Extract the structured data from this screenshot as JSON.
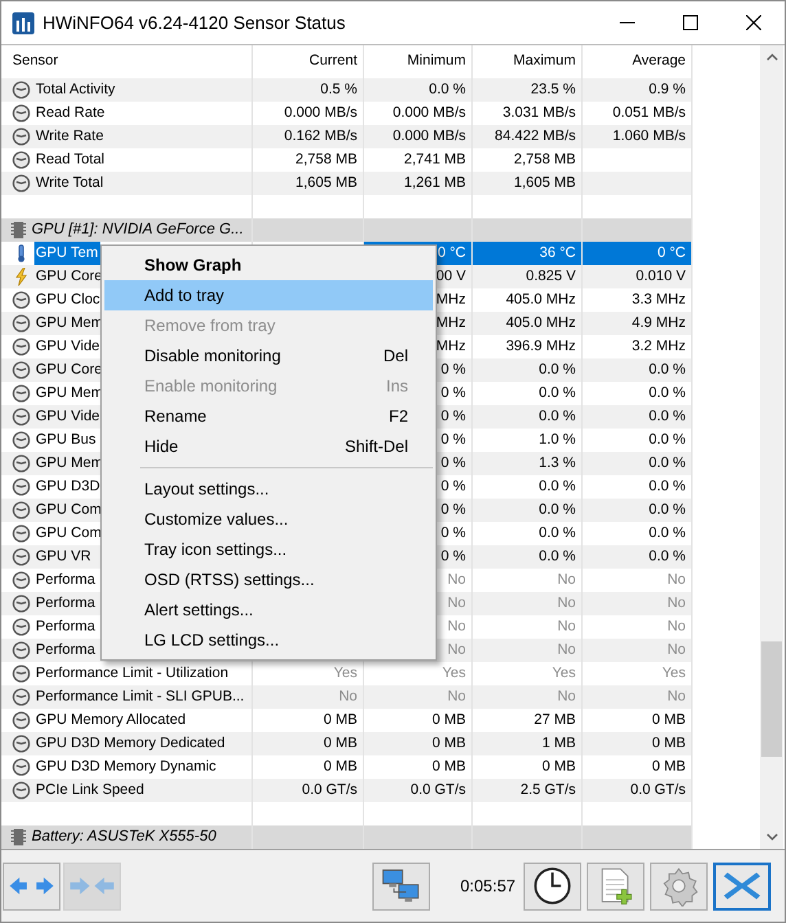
{
  "window": {
    "title": "HWiNFO64 v6.24-4120 Sensor Status"
  },
  "columns": [
    "Sensor",
    "Current",
    "Minimum",
    "Maximum",
    "Average"
  ],
  "rows": [
    {
      "kind": "gauge",
      "sensor": "Total Activity",
      "current": "0.5 %",
      "minimum": "0.0 %",
      "maximum": "23.5 %",
      "average": "0.9 %",
      "dimmed": false,
      "selected": false
    },
    {
      "kind": "gauge",
      "sensor": "Read Rate",
      "current": "0.000 MB/s",
      "minimum": "0.000 MB/s",
      "maximum": "3.031 MB/s",
      "average": "0.051 MB/s",
      "dimmed": false,
      "selected": false
    },
    {
      "kind": "gauge",
      "sensor": "Write Rate",
      "current": "0.162 MB/s",
      "minimum": "0.000 MB/s",
      "maximum": "84.422 MB/s",
      "average": "1.060 MB/s",
      "dimmed": false,
      "selected": false
    },
    {
      "kind": "gauge",
      "sensor": "Read Total",
      "current": "2,758 MB",
      "minimum": "2,741 MB",
      "maximum": "2,758 MB",
      "dimmed": false,
      "selected": false
    },
    {
      "kind": "gauge",
      "sensor": "Write Total",
      "current": "1,605 MB",
      "minimum": "1,261 MB",
      "maximum": "1,605 MB",
      "dimmed": false,
      "selected": false
    },
    {
      "kind": "blank"
    },
    {
      "kind": "header",
      "label": "GPU [#1]: NVIDIA GeForce G..."
    },
    {
      "kind": "temperature",
      "sensor": "GPU Tem",
      "minimum": "0 °C",
      "maximum": "36 °C",
      "average": "0 °C",
      "dimmed": false,
      "selected": true
    },
    {
      "kind": "voltage",
      "sensor": "GPU Core",
      "minimum": "00 V",
      "maximum": "0.825 V",
      "average": "0.010 V",
      "dimmed": false,
      "selected": false
    },
    {
      "kind": "gauge",
      "sensor": "GPU Cloc",
      "minimum": "MHz",
      "maximum": "405.0 MHz",
      "average": "3.3 MHz",
      "dimmed": false,
      "selected": false
    },
    {
      "kind": "gauge",
      "sensor": "GPU Mem",
      "minimum": "MHz",
      "maximum": "405.0 MHz",
      "average": "4.9 MHz",
      "dimmed": false,
      "selected": false
    },
    {
      "kind": "gauge",
      "sensor": "GPU Vide",
      "minimum": "MHz",
      "maximum": "396.9 MHz",
      "average": "3.2 MHz",
      "dimmed": false,
      "selected": false
    },
    {
      "kind": "gauge",
      "sensor": "GPU Core",
      "minimum": "0 %",
      "maximum": "0.0 %",
      "average": "0.0 %",
      "dimmed": false,
      "selected": false
    },
    {
      "kind": "gauge",
      "sensor": "GPU Mem",
      "minimum": "0 %",
      "maximum": "0.0 %",
      "average": "0.0 %",
      "dimmed": false,
      "selected": false
    },
    {
      "kind": "gauge",
      "sensor": "GPU Vide",
      "minimum": "0 %",
      "maximum": "0.0 %",
      "average": "0.0 %",
      "dimmed": false,
      "selected": false
    },
    {
      "kind": "gauge",
      "sensor": "GPU Bus",
      "minimum": "0 %",
      "maximum": "1.0 %",
      "average": "0.0 %",
      "dimmed": false,
      "selected": false
    },
    {
      "kind": "gauge",
      "sensor": "GPU Mem",
      "minimum": "0 %",
      "maximum": "1.3 %",
      "average": "0.0 %",
      "dimmed": false,
      "selected": false
    },
    {
      "kind": "gauge",
      "sensor": "GPU D3D",
      "minimum": "0 %",
      "maximum": "0.0 %",
      "average": "0.0 %",
      "dimmed": false,
      "selected": false
    },
    {
      "kind": "gauge",
      "sensor": "GPU Com",
      "minimum": "0 %",
      "maximum": "0.0 %",
      "average": "0.0 %",
      "dimmed": false,
      "selected": false
    },
    {
      "kind": "gauge",
      "sensor": "GPU Com",
      "minimum": "0 %",
      "maximum": "0.0 %",
      "average": "0.0 %",
      "dimmed": false,
      "selected": false
    },
    {
      "kind": "gauge",
      "sensor": "GPU VR",
      "minimum": "0 %",
      "maximum": "0.0 %",
      "average": "0.0 %",
      "dimmed": false,
      "selected": false
    },
    {
      "kind": "gauge",
      "sensor": "Performa",
      "minimum": "No",
      "maximum": "No",
      "average": "No",
      "dimmed": true,
      "selected": false
    },
    {
      "kind": "gauge",
      "sensor": "Performa",
      "minimum": "No",
      "maximum": "No",
      "average": "No",
      "dimmed": true,
      "selected": false
    },
    {
      "kind": "gauge",
      "sensor": "Performa",
      "minimum": "No",
      "maximum": "No",
      "average": "No",
      "dimmed": true,
      "selected": false
    },
    {
      "kind": "gauge",
      "sensor": "Performa",
      "minimum": "No",
      "maximum": "No",
      "average": "No",
      "dimmed": true,
      "selected": false
    },
    {
      "kind": "gauge",
      "sensor": "Performance Limit - Utilization",
      "current": "Yes",
      "minimum": "Yes",
      "maximum": "Yes",
      "average": "Yes",
      "dimmed": true,
      "selected": false
    },
    {
      "kind": "gauge",
      "sensor": "Performance Limit - SLI GPUB...",
      "current": "No",
      "minimum": "No",
      "maximum": "No",
      "average": "No",
      "dimmed": true,
      "selected": false
    },
    {
      "kind": "gauge",
      "sensor": "GPU Memory Allocated",
      "current": "0 MB",
      "minimum": "0 MB",
      "maximum": "27 MB",
      "average": "0 MB",
      "dimmed": false,
      "selected": false
    },
    {
      "kind": "gauge",
      "sensor": "GPU D3D Memory Dedicated",
      "current": "0 MB",
      "minimum": "0 MB",
      "maximum": "1 MB",
      "average": "0 MB",
      "dimmed": false,
      "selected": false
    },
    {
      "kind": "gauge",
      "sensor": "GPU D3D Memory Dynamic",
      "current": "0 MB",
      "minimum": "0 MB",
      "maximum": "0 MB",
      "average": "0 MB",
      "dimmed": false,
      "selected": false
    },
    {
      "kind": "gauge",
      "sensor": "PCIe Link Speed",
      "current": "0.0 GT/s",
      "minimum": "0.0 GT/s",
      "maximum": "2.5 GT/s",
      "average": "0.0 GT/s",
      "dimmed": false,
      "selected": false
    },
    {
      "kind": "blank"
    },
    {
      "kind": "header",
      "label": "Battery: ASUSTeK X555-50"
    }
  ],
  "context_menu": [
    {
      "kind": "item",
      "label": "Show Graph",
      "default": true,
      "disabled": false,
      "selected": false
    },
    {
      "kind": "item",
      "label": "Add to tray",
      "default": false,
      "disabled": false,
      "selected": true
    },
    {
      "kind": "item",
      "label": "Remove from tray",
      "default": false,
      "disabled": true,
      "selected": false
    },
    {
      "kind": "item",
      "label": "Disable monitoring",
      "shortcut": "Del",
      "default": false,
      "disabled": false,
      "selected": false
    },
    {
      "kind": "item",
      "label": "Enable monitoring",
      "shortcut": "Ins",
      "default": false,
      "disabled": true,
      "selected": false
    },
    {
      "kind": "item",
      "label": "Rename",
      "shortcut": "F2",
      "default": false,
      "disabled": false,
      "selected": false
    },
    {
      "kind": "item",
      "label": "Hide",
      "shortcut": "Shift-Del",
      "default": false,
      "disabled": false,
      "selected": false
    },
    {
      "kind": "separator"
    },
    {
      "kind": "item",
      "label": "Layout settings...",
      "default": false,
      "disabled": false,
      "selected": false
    },
    {
      "kind": "item",
      "label": "Customize values...",
      "default": false,
      "disabled": false,
      "selected": false
    },
    {
      "kind": "item",
      "label": "Tray icon settings...",
      "default": false,
      "disabled": false,
      "selected": false
    },
    {
      "kind": "item",
      "label": "OSD (RTSS) settings...",
      "default": false,
      "disabled": false,
      "selected": false
    },
    {
      "kind": "item",
      "label": "Alert settings...",
      "default": false,
      "disabled": false,
      "selected": false
    },
    {
      "kind": "item",
      "label": "LG LCD settings...",
      "default": false,
      "disabled": false,
      "selected": false
    }
  ],
  "toolbar": {
    "elapsed": "0:05:57",
    "buttons": [
      {
        "kind": "expand",
        "disabled": false
      },
      {
        "kind": "collapse",
        "disabled": true
      },
      {
        "kind": "network",
        "disabled": false
      },
      {
        "kind": "clock",
        "disabled": false
      },
      {
        "kind": "report",
        "disabled": false
      },
      {
        "kind": "settings",
        "disabled": false
      },
      {
        "kind": "close",
        "disabled": false
      }
    ]
  }
}
